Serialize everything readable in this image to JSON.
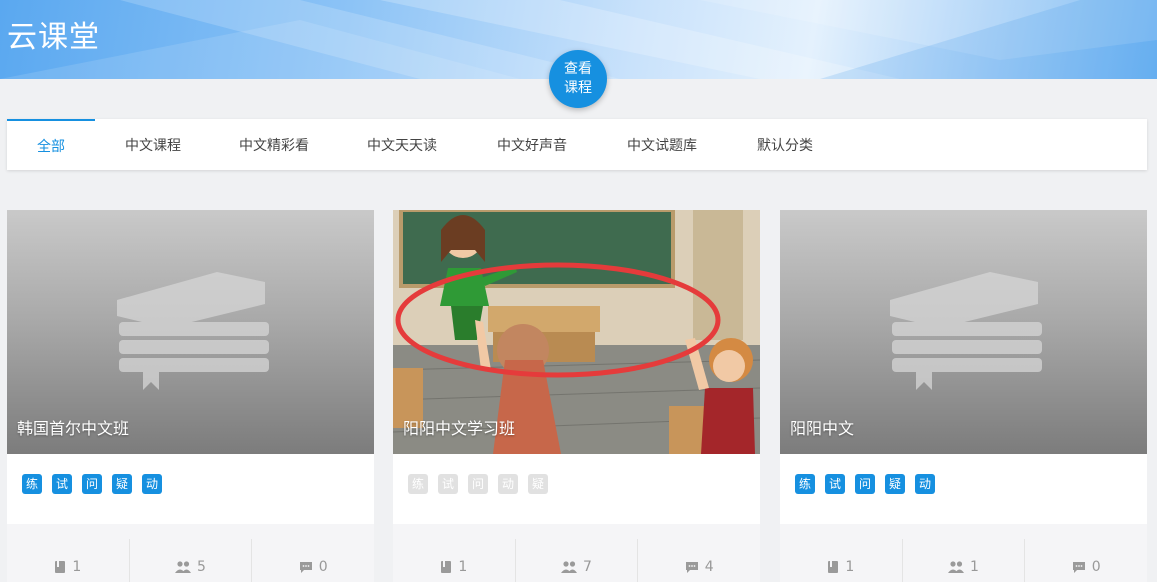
{
  "app": {
    "brand": "云课堂"
  },
  "view_button": {
    "line1": "查看",
    "line2": "课程"
  },
  "tabs": [
    {
      "label": "全部",
      "active": true
    },
    {
      "label": "中文课程"
    },
    {
      "label": "中文精彩看"
    },
    {
      "label": "中文天天读"
    },
    {
      "label": "中文好声音"
    },
    {
      "label": "中文试题库"
    },
    {
      "label": "默认分类"
    }
  ],
  "colors": {
    "accent": "#1690e0",
    "tag_disabled": "#e1e1e1"
  },
  "cards": [
    {
      "title": "韩国首尔中文班",
      "cover": "book-placeholder-icon",
      "tags": [
        "练",
        "试",
        "问",
        "疑",
        "动"
      ],
      "tags_enabled": true,
      "stats": {
        "lessons": "1",
        "members": "5",
        "comments": "0"
      }
    },
    {
      "title": "阳阳中文学习班",
      "cover": "classroom-illustration",
      "tags": [
        "练",
        "试",
        "问",
        "动",
        "疑"
      ],
      "tags_enabled": false,
      "stats": {
        "lessons": "1",
        "members": "7",
        "comments": "4"
      }
    },
    {
      "title": "阳阳中文",
      "cover": "book-placeholder-icon",
      "tags": [
        "练",
        "试",
        "问",
        "疑",
        "动"
      ],
      "tags_enabled": true,
      "stats": {
        "lessons": "1",
        "members": "1",
        "comments": "0"
      }
    }
  ]
}
